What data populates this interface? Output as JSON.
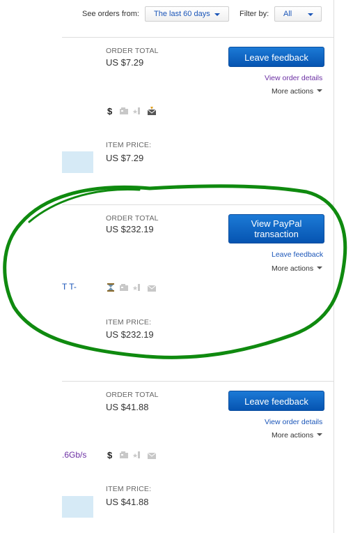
{
  "filter": {
    "see_orders_label": "See orders from:",
    "period_value": "The last 60 days",
    "filter_label": "Filter by:",
    "filter_value": "All"
  },
  "orders": [
    {
      "order_total_label": "ORDER TOTAL",
      "order_total": "US $7.29",
      "primary_button": "Leave feedback",
      "secondary_link": "View order details",
      "more_actions": "More actions",
      "item_title_fragment": "",
      "item_price_label": "ITEM PRICE:",
      "item_price": "US $7.29",
      "status_icons": [
        "dollar-icon",
        "shipping-card-icon",
        "star-feedback-icon",
        "mail-received-icon"
      ]
    },
    {
      "order_total_label": "ORDER TOTAL",
      "order_total": "US $232.19",
      "primary_button_line1": "View PayPal",
      "primary_button_line2": "transaction",
      "secondary_link": "Leave feedback",
      "more_actions": "More actions",
      "item_title_fragment": "T T-",
      "item_price_label": "ITEM PRICE:",
      "item_price": "US $232.19",
      "status_icons": [
        "hourglass-icon",
        "shipping-card-icon",
        "star-feedback-icon",
        "mail-icon"
      ]
    },
    {
      "order_total_label": "ORDER TOTAL",
      "order_total": "US $41.88",
      "primary_button": "Leave feedback",
      "secondary_link": "View order details",
      "more_actions": "More actions",
      "item_title_fragment": ".6Gb/s",
      "item_price_label": "ITEM PRICE:",
      "item_price": "US $41.88",
      "status_icons": [
        "dollar-icon",
        "shipping-card-icon",
        "star-feedback-icon",
        "mail-icon"
      ]
    }
  ],
  "colors": {
    "button_blue": "#0654b1",
    "link_blue": "#1a55b8",
    "visited_purple": "#6b2fa3",
    "annotation_green": "#0f8a0f",
    "thumbnail": "#d6eaf6"
  }
}
